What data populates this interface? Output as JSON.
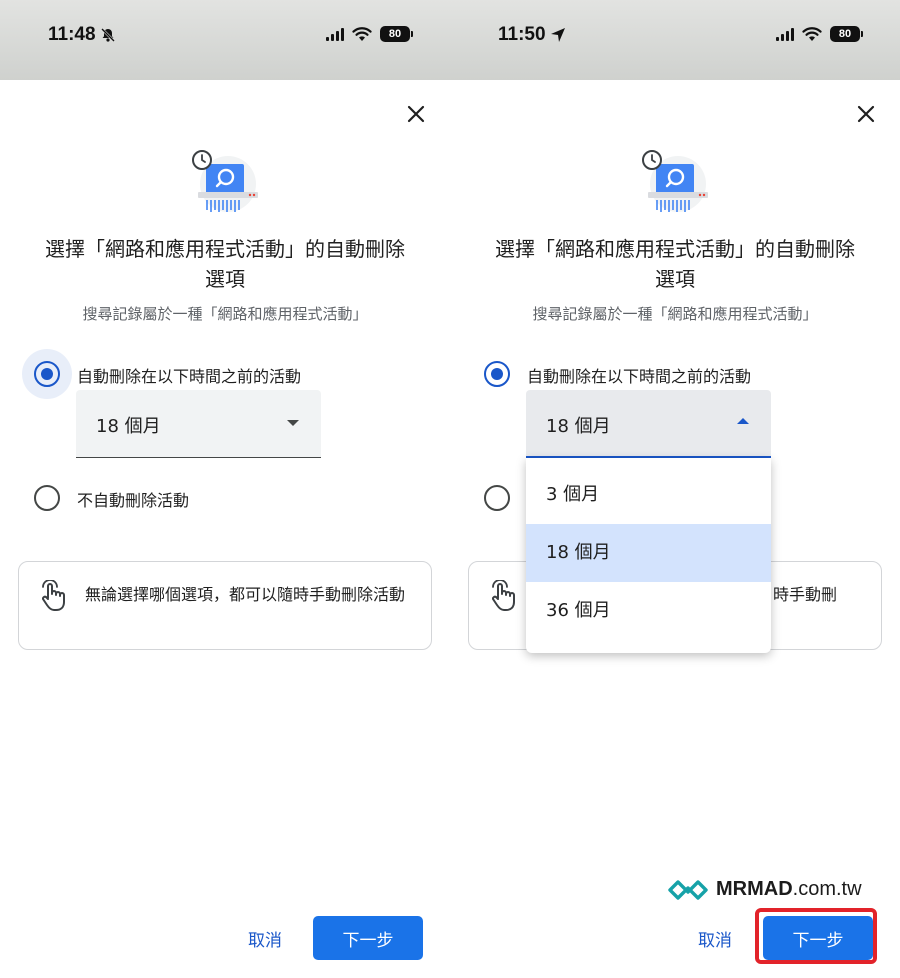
{
  "left_screen": {
    "status_bar": {
      "time": "11:48",
      "time_icon": "bell-slash-icon",
      "battery": "80"
    },
    "dialog": {
      "title": "選擇「網路和應用程式活動」的自動刪除選項",
      "subtitle": "搜尋記錄屬於一種「網路和應用程式活動」",
      "option_auto": {
        "label": "自動刪除在以下時間之前的活動",
        "selected": true
      },
      "period_select": {
        "value": "18 個月",
        "expanded": false
      },
      "option_none": {
        "label": "不自動刪除活動",
        "selected": false
      },
      "info": "無論選擇哪個選項，都可以隨時手動刪除活動",
      "cancel_label": "取消",
      "next_label": "下一步"
    }
  },
  "right_screen": {
    "status_bar": {
      "time": "11:50",
      "time_icon": "location-arrow-icon",
      "battery": "80"
    },
    "dialog": {
      "title": "選擇「網路和應用程式活動」的自動刪除選項",
      "subtitle": "搜尋記錄屬於一種「網路和應用程式活動」",
      "option_auto": {
        "label": "自動刪除在以下時間之前的活動",
        "selected": true
      },
      "period_select": {
        "value": "18 個月",
        "expanded": true
      },
      "dropdown_options": [
        "3 個月",
        "18 個月",
        "36 個月"
      ],
      "dropdown_selected": "18 個月",
      "info_visible": "時手動刪",
      "cancel_label": "取消",
      "next_label": "下一步"
    },
    "watermark": {
      "brand": "MRMAD",
      "domain": ".com.tw"
    }
  },
  "colors": {
    "accent": "#1a73e8",
    "radio": "#1a57c9",
    "highlight": "#e2232a",
    "selected_option": "#d3e3fd"
  }
}
